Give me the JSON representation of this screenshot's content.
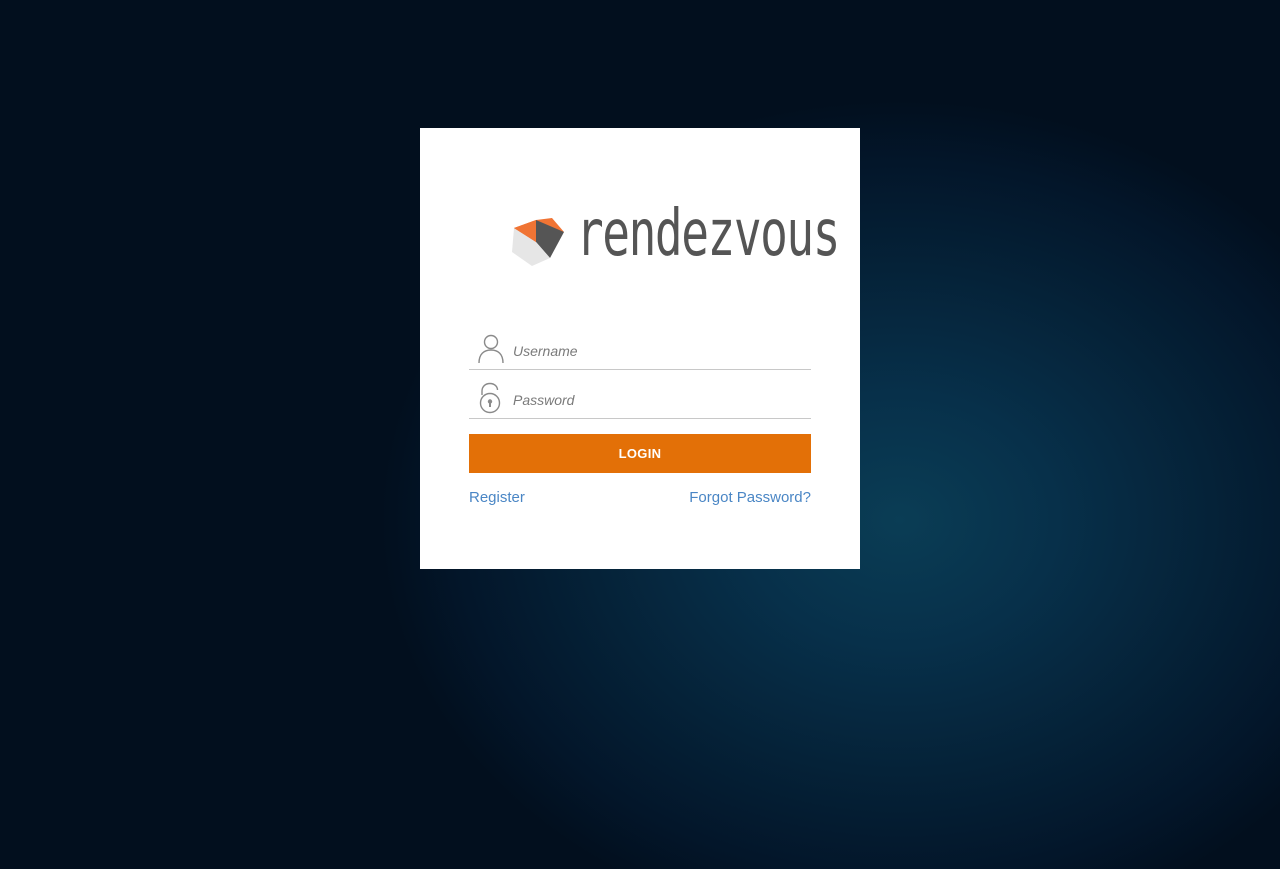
{
  "app": {
    "logo_text": "rendezvous"
  },
  "login_form": {
    "username_placeholder": "Username",
    "password_placeholder": "Password",
    "login_label": "LOGIN",
    "register_label": "Register",
    "forgot_password_label": "Forgot Password?"
  },
  "colors": {
    "accent": "#e37007",
    "link": "#4a86c5",
    "logo_gray": "#555555",
    "background_dark": "#020f1e",
    "background_glow": "#0a3d55"
  },
  "icons": {
    "username": "user-icon",
    "password": "unlock-icon",
    "logo": "cube-icon"
  }
}
